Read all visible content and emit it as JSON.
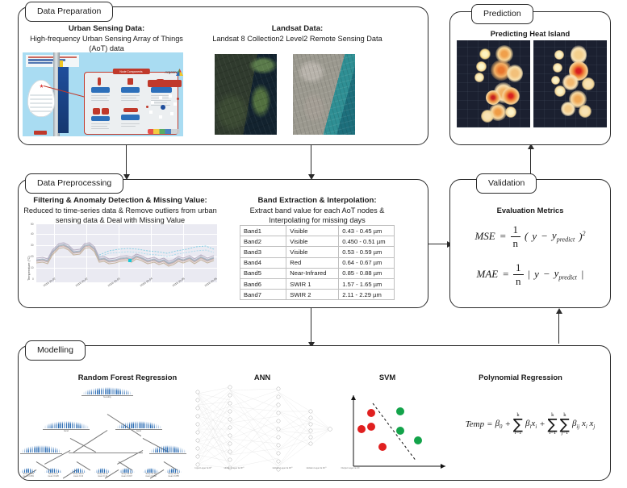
{
  "stages": {
    "data_preparation": {
      "tag": "Data Preparation",
      "urban": {
        "title": "Urban Sensing Data:",
        "subtitle": "High-frequency Urban Sensing Array of Things (AoT) data",
        "image_name": "aot-architecture-infographic"
      },
      "landsat": {
        "title": "Landsat Data:",
        "subtitle": "Landsat 8 Collection2 Level2 Remote Sensing Data",
        "image_left_name": "landsat-scene-vegetation",
        "image_right_name": "landsat-scene-truecolor"
      }
    },
    "data_preprocessing": {
      "tag": "Data Preprocessing",
      "filtering": {
        "title": "Filtering & Anomaly Detection & Missing Value:",
        "subtitle": "Reduced to time-series data & Remove outliers from urban sensing data & Deal with Missing Value",
        "chart_caption": "temperature-time-series"
      },
      "band": {
        "title": "Band Extraction & Interpolation:",
        "subtitle": "Extract band value for each AoT nodes & Interpolating for missing days",
        "rows": [
          {
            "band": "Band1",
            "type": "Visible",
            "range": "0.43 - 0.45 µm"
          },
          {
            "band": "Band2",
            "type": "Visible",
            "range": "0.450 - 0.51 µm"
          },
          {
            "band": "Band3",
            "type": "Visible",
            "range": "0.53 - 0.59 µm"
          },
          {
            "band": "Band4",
            "type": "Red",
            "range": "0.64 - 0.67 µm"
          },
          {
            "band": "Band5",
            "type": "Near-Infrared",
            "range": "0.85 - 0.88 µm"
          },
          {
            "band": "Band6",
            "type": "SWIR 1",
            "range": "1.57 - 1.65 µm"
          },
          {
            "band": "Band7",
            "type": "SWIR 2",
            "range": "2.11 - 2.29 µm"
          }
        ]
      }
    },
    "modelling": {
      "tag": "Modelling",
      "models": [
        {
          "title": "Random Forest Regression"
        },
        {
          "title": "ANN"
        },
        {
          "title": "SVM"
        },
        {
          "title": "Polynomial Regression"
        }
      ],
      "ann_layer_labels": [
        "Input Layer ∈ R⁶",
        "Hidden Layer ∈ R³⁰",
        "Hidden Layer ∈ R³⁰",
        "Hidden Layer ∈ R¹⁰",
        "Output Layer ∈ R¹"
      ],
      "poly_formula": {
        "lhs": "Temp",
        "eq": "=",
        "b0": "β",
        "b0_sub": "0",
        "plus1": "+",
        "sum1_top": "k",
        "sum1_bottom": "i=1",
        "term1": "β",
        "term1_sub": "i",
        "term1_x": "x",
        "term1_xsub": "i",
        "plus2": "+",
        "sum2_top": "k",
        "sum2_bottom": "i=1",
        "sum3_top": "k",
        "sum3_bottom": "j=1",
        "term2": "β",
        "term2_sub": "ij",
        "term2_x1": "x",
        "term2_x1sub": "i",
        "term2_x2": "x",
        "term2_x2sub": "j"
      }
    },
    "validation": {
      "tag": "Validation",
      "title": "Evaluation Metrics",
      "mse": {
        "name": "MSE",
        "eq": "=",
        "num": "1",
        "den": "n",
        "body_open": "(",
        "y": "y",
        "minus": "−",
        "ypred": "y",
        "ypred_sub": "predict",
        "body_close": ")",
        "power": "2"
      },
      "mae": {
        "name": "MAE",
        "eq": "=",
        "num": "1",
        "den": "n",
        "body_open": "|",
        "y": "y",
        "minus": "−",
        "ypred": "y",
        "ypred_sub": "predict",
        "body_close": "|"
      }
    },
    "prediction": {
      "tag": "Prediction",
      "title": "Predicting Heat Island",
      "map_left_name": "heat-island-map-scenario-a",
      "map_right_name": "heat-island-map-scenario-b"
    }
  },
  "chart_data": {
    "type": "line",
    "title": "",
    "xlabel": "",
    "ylabel": "Temperature (°C)",
    "ylim": [
      0,
      50
    ],
    "yticks": [
      0,
      10,
      20,
      30,
      40,
      50
    ],
    "xtick_labels": [
      "2019-10-02",
      "2019-10-02",
      "2019-10-03",
      "2019-10-04",
      "2019-10-05",
      "2019-10-06"
    ],
    "grid": true,
    "series_note": "many overlapping AoT node temperature traces plus cyan outlier trace",
    "mean_values": [
      21,
      22,
      26,
      31,
      30,
      27,
      29,
      33,
      30,
      20,
      19,
      22,
      21,
      23,
      22,
      20,
      19,
      21,
      20,
      18,
      17,
      19,
      22,
      24,
      21,
      19,
      21,
      23,
      20,
      24
    ]
  },
  "flow": {
    "arrows": [
      {
        "from": "data-preparation",
        "to": "data-preprocessing",
        "direction": "down"
      },
      {
        "from": "data-preparation",
        "to": "data-preprocessing",
        "direction": "down"
      },
      {
        "from": "data-preprocessing",
        "to": "modelling",
        "direction": "down"
      },
      {
        "from": "data-preprocessing",
        "to": "validation",
        "direction": "right"
      },
      {
        "from": "modelling",
        "to": "validation",
        "direction": "up"
      },
      {
        "from": "validation",
        "to": "prediction",
        "direction": "up"
      }
    ]
  }
}
